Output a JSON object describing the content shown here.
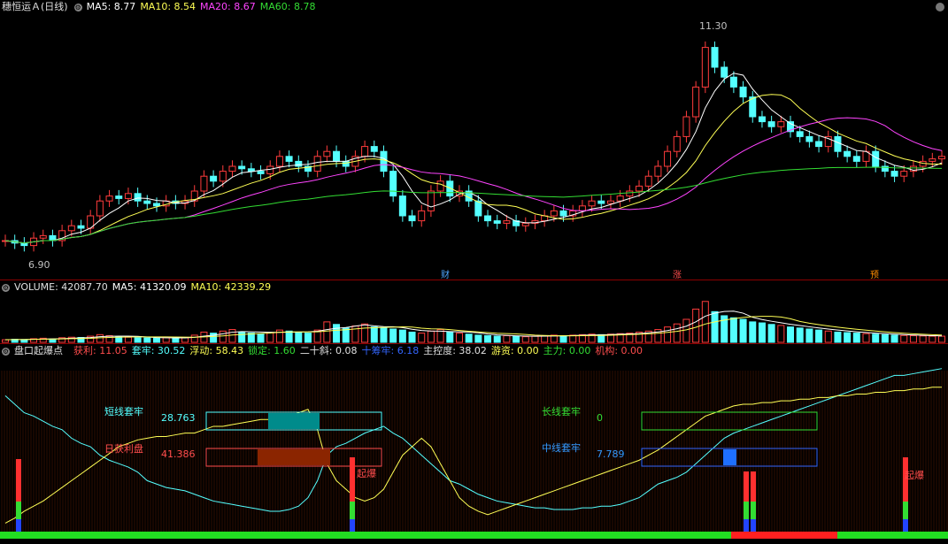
{
  "price_header": {
    "title": "穗恒运Ａ(日线)",
    "ma5": "MA5: 8.77",
    "ma10": "MA10: 8.54",
    "ma20": "MA20: 8.67",
    "ma60": "MA60: 8.78",
    "high_label": "11.30",
    "low_label": "6.90",
    "event_markers": [
      "财",
      "涨",
      "预"
    ]
  },
  "volume_header": {
    "title": "VOLUME: 42087.70",
    "ma5": "MA5: 41320.09",
    "ma10": "MA10: 42339.29"
  },
  "indicator_header": {
    "title": "盘口起爆点",
    "profit": "获利: 11.05",
    "trapped": "套牢: 30.52",
    "floating": "浮动: 58.43",
    "locked": "锁定: 1.60",
    "twenty_slope": "二十斜: 0.08",
    "ten_trapped": "十筹牢: 6.18",
    "control": "主控度: 38.02",
    "hot_money": "游资: 0.00",
    "main_force": "主力: 0.00",
    "institution": "机构: 0.00"
  },
  "indicator_labels": {
    "short_trapped": "短线套牢",
    "short_trapped_value": "28.763",
    "daily_profit": "日获利盘",
    "daily_profit_value": "41.386",
    "long_trapped": "长线套牢",
    "long_trapped_value": "0",
    "mid_trapped": "中线套牢",
    "mid_trapped_value": "7.789",
    "explode_a": "起爆",
    "explode_b": "起爆"
  },
  "colors": {
    "up": "#ff3c3c",
    "down": "#54ffff",
    "ma5": "#ffffff",
    "ma10": "#ffff55",
    "ma20": "#ff44ff",
    "ma60": "#33dd33",
    "grid": "#8b0000"
  },
  "chart_data": {
    "type": "candlestick",
    "y_range": [
      6.6,
      11.6
    ],
    "closes": [
      7.1,
      7.05,
      7.0,
      7.15,
      7.2,
      7.1,
      7.3,
      7.4,
      7.35,
      7.6,
      7.9,
      8.0,
      7.95,
      8.05,
      7.9,
      7.85,
      7.8,
      7.9,
      7.85,
      7.9,
      8.1,
      8.4,
      8.3,
      8.5,
      8.6,
      8.55,
      8.5,
      8.45,
      8.6,
      8.8,
      8.7,
      8.6,
      8.5,
      8.8,
      8.9,
      8.7,
      8.6,
      8.8,
      9.0,
      8.9,
      8.5,
      8.0,
      7.6,
      7.5,
      7.7,
      8.1,
      8.3,
      8.0,
      8.1,
      7.9,
      7.6,
      7.5,
      7.45,
      7.5,
      7.4,
      7.45,
      7.5,
      7.6,
      7.7,
      7.6,
      7.7,
      7.8,
      7.9,
      7.85,
      7.9,
      8.0,
      8.1,
      8.2,
      8.4,
      8.6,
      8.9,
      9.2,
      9.6,
      10.2,
      11.0,
      10.6,
      10.4,
      10.2,
      10.0,
      9.6,
      9.5,
      9.4,
      9.5,
      9.3,
      9.2,
      9.1,
      9.0,
      9.2,
      8.9,
      8.8,
      8.7,
      8.9,
      8.6,
      8.5,
      8.4,
      8.5,
      8.6,
      8.7,
      8.75,
      8.8
    ],
    "volume_range": [
      0,
      90000
    ],
    "volumes": [
      5000,
      6000,
      5500,
      7000,
      8000,
      6500,
      9000,
      10000,
      9500,
      12000,
      15000,
      13000,
      11000,
      10000,
      9000,
      8500,
      8000,
      9000,
      8500,
      9000,
      14000,
      20000,
      18000,
      22000,
      25000,
      20000,
      18000,
      16000,
      19000,
      24000,
      22000,
      20000,
      18000,
      24000,
      40000,
      35000,
      28000,
      32000,
      36000,
      30000,
      28000,
      26000,
      24000,
      20000,
      18000,
      22000,
      25000,
      20000,
      18000,
      16000,
      14000,
      13000,
      12000,
      13000,
      12000,
      11000,
      12000,
      13000,
      14000,
      13000,
      14000,
      15000,
      16000,
      15000,
      16000,
      17000,
      18000,
      20000,
      22000,
      25000,
      30000,
      36000,
      45000,
      65000,
      80000,
      60000,
      52000,
      48000,
      45000,
      40000,
      38000,
      35000,
      33000,
      30000,
      28000,
      26000,
      24000,
      22000,
      20000,
      19000,
      18000,
      17000,
      16000,
      15000,
      14000,
      13500,
      13000,
      12500,
      12000,
      12000
    ],
    "indicator_series": {
      "short_trapped": [
        80,
        75,
        70,
        68,
        65,
        62,
        60,
        55,
        52,
        50,
        45,
        42,
        40,
        38,
        35,
        30,
        28,
        26,
        25,
        24,
        22,
        20,
        18,
        17,
        16,
        15,
        14,
        13,
        12,
        12,
        13,
        15,
        20,
        30,
        45,
        50,
        52,
        55,
        58,
        60,
        62,
        58,
        55,
        50,
        45,
        40,
        35,
        30,
        28,
        25,
        22,
        20,
        18,
        17,
        16,
        15,
        14,
        14,
        13,
        13,
        13,
        14,
        14,
        15,
        15,
        16,
        18,
        20,
        24,
        28,
        30,
        32,
        35,
        40,
        45,
        50,
        55,
        58,
        60,
        62,
        64,
        66,
        68,
        70,
        72,
        74,
        76,
        78,
        80,
        82,
        84,
        86,
        88,
        90,
        92,
        92,
        93,
        94,
        95,
        96
      ],
      "daily_profit": [
        5,
        8,
        12,
        15,
        18,
        22,
        26,
        30,
        34,
        38,
        42,
        46,
        50,
        52,
        54,
        55,
        56,
        56,
        57,
        58,
        58,
        60,
        62,
        62,
        63,
        64,
        65,
        66,
        66,
        67,
        68,
        70,
        72,
        60,
        40,
        30,
        25,
        20,
        18,
        20,
        25,
        35,
        45,
        50,
        55,
        50,
        40,
        30,
        20,
        15,
        12,
        10,
        12,
        14,
        16,
        18,
        20,
        22,
        24,
        26,
        28,
        30,
        32,
        34,
        36,
        38,
        40,
        42,
        45,
        48,
        52,
        56,
        60,
        64,
        68,
        70,
        72,
        74,
        75,
        75,
        76,
        76,
        77,
        77,
        78,
        78,
        79,
        79,
        80,
        80,
        81,
        81,
        82,
        82,
        83,
        83,
        84,
        84,
        85,
        85
      ]
    }
  }
}
